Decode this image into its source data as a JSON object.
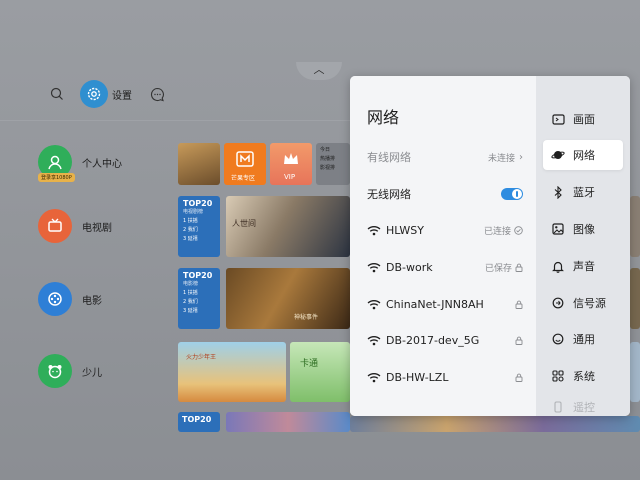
{
  "launcher": {
    "settings_label": "设置",
    "nav": [
      {
        "label": "个人中心",
        "badge": "登录享1080P",
        "color": "#2fae5a"
      },
      {
        "label": "电视剧",
        "color": "#e8643a"
      },
      {
        "label": "电影",
        "color": "#2e7fd6"
      },
      {
        "label": "少儿",
        "color": "#2fae5a"
      }
    ],
    "tiles": {
      "mango_label": "芒果专区",
      "vip_label": "VIP",
      "list_items": [
        "今日",
        "热播排",
        "影视排"
      ],
      "top20_tv": {
        "title": "TOP20",
        "subtitle": "电视剧榜",
        "items": [
          "1 扶摇",
          "2 我们",
          "3 延禧"
        ]
      },
      "top20_movie": {
        "title": "TOP20",
        "subtitle": "电影榜",
        "items": [
          "1 扶摇",
          "2 我们",
          "3 延禧"
        ]
      },
      "top20_bottom": {
        "title": "TOP20"
      },
      "drama_title": "人世间",
      "movie_title": "神秘事件",
      "kids_title": "卡通",
      "kids_tile_2": "火力少年王"
    }
  },
  "panel": {
    "title": "网络",
    "wired": {
      "label": "有线网络",
      "status": "未连接"
    },
    "wireless": {
      "label": "无线网络",
      "enabled": true
    },
    "networks": [
      {
        "ssid": "HLWSY",
        "status": "已连接",
        "status_icon": "check-icon"
      },
      {
        "ssid": "DB-work",
        "status": "已保存",
        "status_icon": "lock-icon"
      },
      {
        "ssid": "ChinaNet-JNN8AH",
        "status": "",
        "status_icon": "lock-icon"
      },
      {
        "ssid": "DB-2017-dev_5G",
        "status": "",
        "status_icon": "lock-icon"
      },
      {
        "ssid": "DB-HW-LZL",
        "status": "",
        "status_icon": "lock-icon"
      }
    ],
    "menu": [
      {
        "label": "画面",
        "icon": "picture-icon"
      },
      {
        "label": "网络",
        "icon": "planet-icon",
        "active": true
      },
      {
        "label": "蓝牙",
        "icon": "bluetooth-icon"
      },
      {
        "label": "图像",
        "icon": "image-icon"
      },
      {
        "label": "声音",
        "icon": "bell-icon"
      },
      {
        "label": "信号源",
        "icon": "signal-source-icon"
      },
      {
        "label": "通用",
        "icon": "general-icon"
      },
      {
        "label": "系统",
        "icon": "grid-icon"
      },
      {
        "label": "遥控",
        "icon": "remote-icon",
        "faded": true
      }
    ],
    "accent_color": "#2e8ce0"
  }
}
